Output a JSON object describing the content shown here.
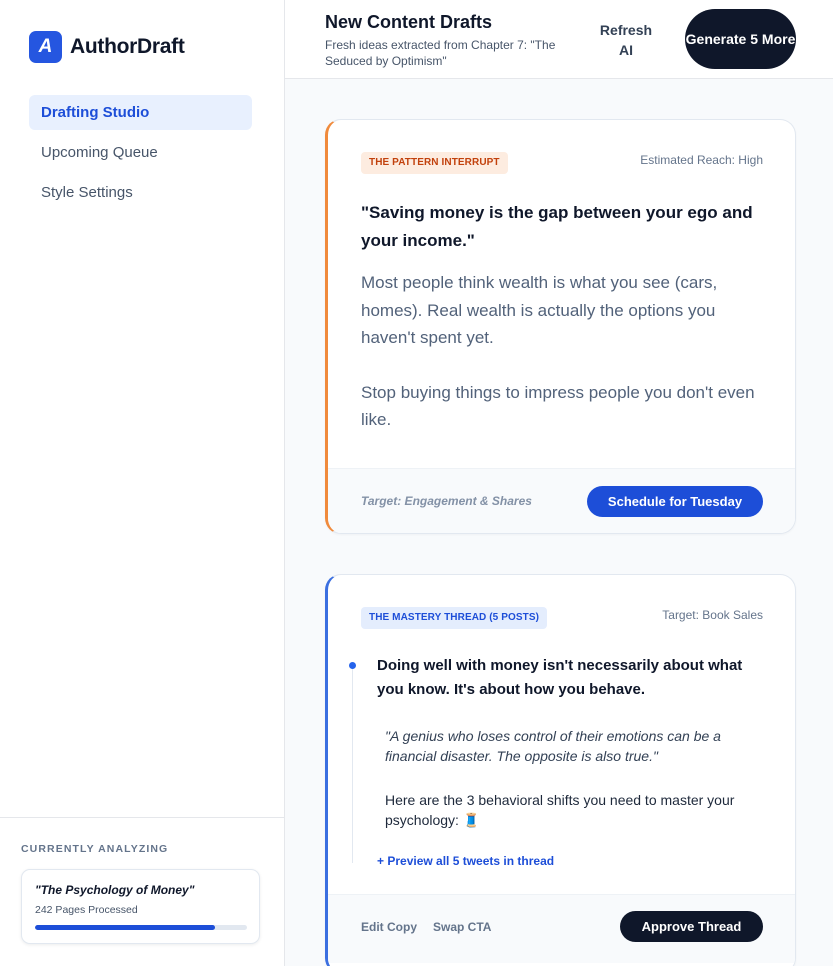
{
  "app": {
    "logo_letter": "A",
    "name": "AuthorDraft",
    "accent": "#2556e0"
  },
  "sidebar": {
    "items": [
      {
        "label": "Drafting Studio",
        "active": true
      },
      {
        "label": "Upcoming Queue",
        "active": false
      },
      {
        "label": "Style Settings",
        "active": false
      }
    ],
    "analyzing": {
      "caption": "CURRENTLY ANALYZING",
      "book_title": "\"The Psychology of Money\"",
      "pages": "242 Pages Processed",
      "progress_fraction": 0.85
    }
  },
  "header": {
    "title": "New Content Drafts",
    "subtitle": "Fresh ideas extracted from Chapter 7: \"The Seduced by Optimism\"",
    "refresh_label": "Refresh AI",
    "generate_label": "Generate 5 More"
  },
  "cards": [
    {
      "tag": "THE PATTERN INTERRUPT",
      "meta": "Estimated Reach: High",
      "quote": "\"Saving money is the gap between your ego and your income.\"",
      "body": [
        "Most people think wealth is what you see (cars, homes). Real wealth is actually the options you haven't spent yet.",
        "Stop buying things to impress people you don't even like."
      ],
      "footer_note": "Target: Engagement & Shares",
      "action_label": "Schedule for Tuesday",
      "accent": "#f08a3c"
    },
    {
      "tag": "THE MASTERY THREAD (5 POSTS)",
      "meta": "Target: Book Sales",
      "headline": "Doing well with money isn't necessarily about what you know. It's about how you behave.",
      "quote": "\"A genius who loses control of their emotions can be a financial disaster. The opposite is also true.\"",
      "shifts": "Here are the 3 behavioral shifts you need to master your psychology: 🧵",
      "preview_link": "+ Preview all 5 tweets in thread",
      "edit_label": "Edit Copy",
      "swap_label": "Swap CTA",
      "action_label": "Approve Thread",
      "accent": "#3b6fe0"
    }
  ]
}
